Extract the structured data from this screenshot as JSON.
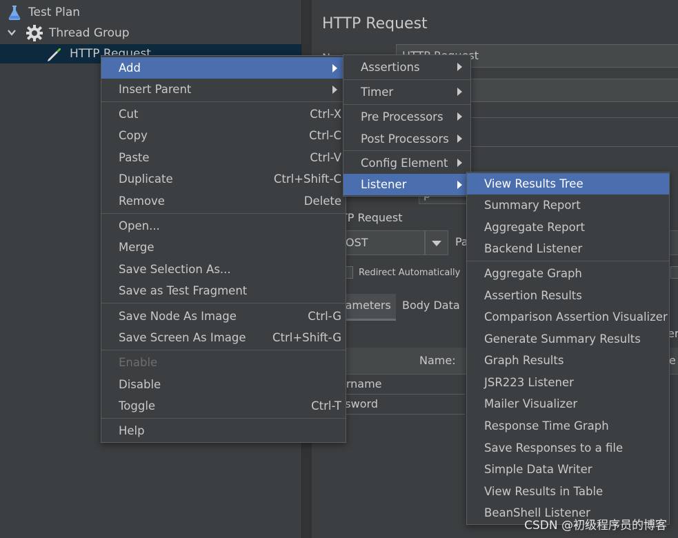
{
  "tree": {
    "items": [
      {
        "label": "Test Plan",
        "icon": "flask-icon"
      },
      {
        "label": "Thread Group",
        "icon": "gear-icon"
      },
      {
        "label": "HTTP Request",
        "icon": "pipette-icon"
      }
    ]
  },
  "right_panel": {
    "title": "HTTP Request",
    "name_label": "N",
    "name_value": "HTTP Request",
    "http_request_group": "TP Request",
    "method_value": "OST",
    "path_label_fragment": "Pa",
    "redirect_label": "Redirect Automatically",
    "tab_parameters": "rameters",
    "tab_body_data": "Body Data",
    "col_name": "Name:",
    "col_fragment_right": "e",
    "right_fragment": "er",
    "row1": "ername",
    "row2": "ssword",
    "method_fragment": "p"
  },
  "context_menu": {
    "items": [
      {
        "label": "Add",
        "submenu": true,
        "highlighted": true
      },
      {
        "label": "Insert Parent",
        "submenu": true
      },
      {
        "label": "Cut",
        "shortcut": "Ctrl-X"
      },
      {
        "label": "Copy",
        "shortcut": "Ctrl-C"
      },
      {
        "label": "Paste",
        "shortcut": "Ctrl-V"
      },
      {
        "label": "Duplicate",
        "shortcut": "Ctrl+Shift-C"
      },
      {
        "label": "Remove",
        "shortcut": "Delete"
      },
      {
        "label": "Open..."
      },
      {
        "label": "Merge"
      },
      {
        "label": "Save Selection As..."
      },
      {
        "label": "Save as Test Fragment"
      },
      {
        "label": "Save Node As Image",
        "shortcut": "Ctrl-G"
      },
      {
        "label": "Save Screen As Image",
        "shortcut": "Ctrl+Shift-G"
      },
      {
        "label": "Enable",
        "disabled": true
      },
      {
        "label": "Disable"
      },
      {
        "label": "Toggle",
        "shortcut": "Ctrl-T"
      },
      {
        "label": "Help"
      }
    ]
  },
  "add_submenu": {
    "items": [
      {
        "label": "Assertions"
      },
      {
        "label": "Timer"
      },
      {
        "label": "Pre Processors"
      },
      {
        "label": "Post Processors"
      },
      {
        "label": "Config Element"
      },
      {
        "label": "Listener",
        "highlighted": true
      }
    ]
  },
  "listener_submenu": {
    "items": [
      {
        "label": "View Results Tree",
        "highlighted": true
      },
      {
        "label": "Summary Report"
      },
      {
        "label": "Aggregate Report"
      },
      {
        "label": "Backend Listener"
      },
      {
        "label": "Aggregate Graph"
      },
      {
        "label": "Assertion Results"
      },
      {
        "label": "Comparison Assertion Visualizer"
      },
      {
        "label": "Generate Summary Results"
      },
      {
        "label": "Graph Results"
      },
      {
        "label": "JSR223 Listener"
      },
      {
        "label": "Mailer Visualizer"
      },
      {
        "label": "Response Time Graph"
      },
      {
        "label": "Save Responses to a file"
      },
      {
        "label": "Simple Data Writer"
      },
      {
        "label": "View Results in Table"
      },
      {
        "label": "BeanShell Listener"
      }
    ]
  },
  "colors": {
    "background": "#3c3f41",
    "highlight": "#4b6eaf",
    "tree_selection": "#0d293e",
    "text": "#c9c9c9"
  },
  "watermark": "CSDN @初级程序员的博客"
}
